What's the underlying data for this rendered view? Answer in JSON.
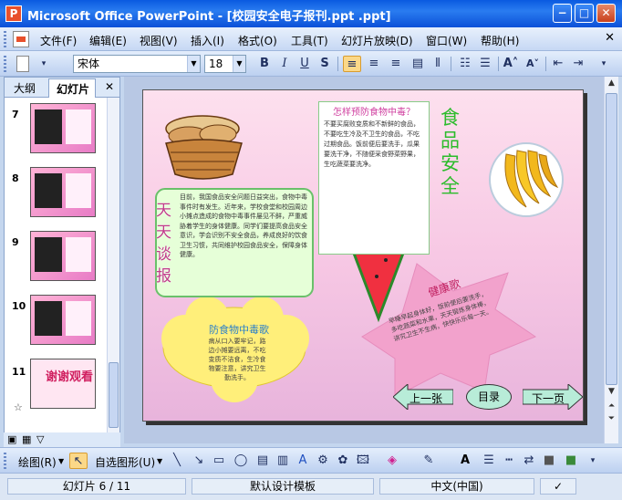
{
  "window": {
    "title": "Microsoft Office PowerPoint - [校园安全电子报刊.ppt .ppt]",
    "app_icon": "P",
    "min": "−",
    "max": "□",
    "close": "✕"
  },
  "menu": {
    "items": [
      "文件(F)",
      "编辑(E)",
      "视图(V)",
      "插入(I)",
      "格式(O)",
      "工具(T)",
      "幻灯片放映(D)",
      "窗口(W)",
      "帮助(H)"
    ],
    "close": "✕"
  },
  "toolbar": {
    "font": "宋体",
    "size": "18",
    "bold": "B",
    "italic": "I",
    "underline": "U",
    "shadow": "S"
  },
  "panel": {
    "tab_outline": "大纲",
    "tab_slides": "幻灯片",
    "close": "✕",
    "slides": [
      "7",
      "8",
      "9",
      "10",
      "11"
    ],
    "last_thumb_text": "谢谢观看"
  },
  "slide": {
    "vertical_title": "天天谈报",
    "heading_prevent": "怎样预防食物中毒？",
    "prevent_text": "不要买腐败变质和不新鲜的食品，不要吃生冷及不卫生的食品，不吃过期食品。饭前便后要洗手，瓜果要洗干净，不随便采食野菜野果，生吃蔬菜要洗净。",
    "food_safety": "食品安全",
    "left_text": "目前，我国食品安全问题日益突出，食物中毒事件时有发生。近年来，学校食堂和校园周边小摊点造成的食物中毒事件屡见不鲜，严重威胁着学生的身体健康。同学们要提高食品安全意识，学会识别不安全食品，养成良好的饮食卫生习惯，共同维护校园食品安全，保障身体健康。",
    "cloud_title": "防食物中毒歌",
    "cloud_text": "病从口入要牢记，路边小摊要远离，不吃变质不洁食，生冷食物要注意，讲究卫生勤洗手。",
    "health_title": "健康歌",
    "health_text": "早睡早起身体好，饭前便后要洗手，多吃蔬菜和水果，天天锻炼身体棒，讲究卫生不生病，快快乐乐每一天。",
    "nav_prev": "上一张",
    "nav_menu": "目录",
    "nav_next": "下一页"
  },
  "drawbar": {
    "draw": "绘图(R)",
    "autoshape": "自选图形(U)"
  },
  "status": {
    "slide": "幻灯片 6 / 11",
    "template": "默认设计模板",
    "language": "中文(中国)"
  }
}
